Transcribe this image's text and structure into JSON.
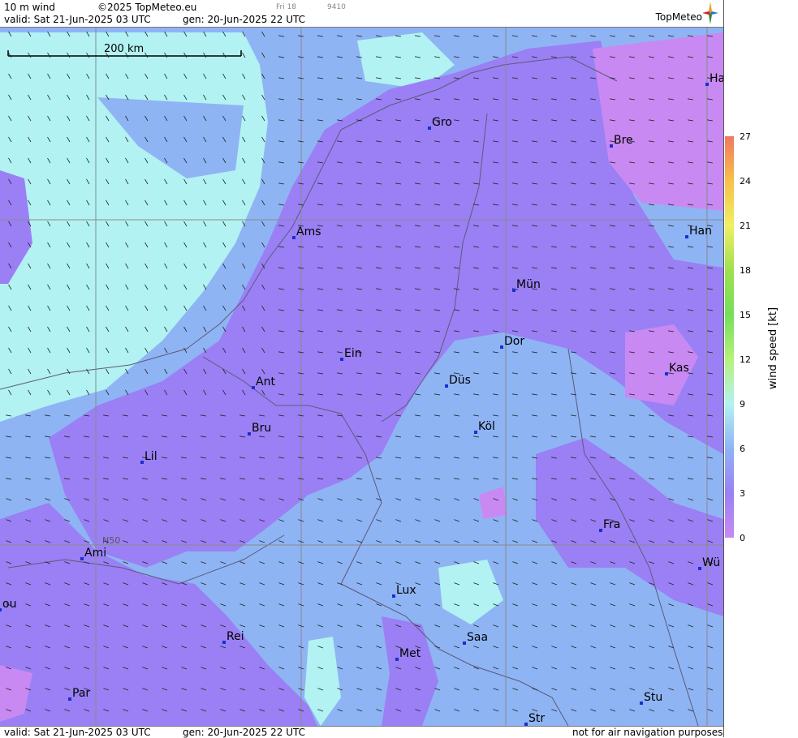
{
  "header": {
    "product": "10 m wind",
    "copyright": "©2025 TopMeteo.eu",
    "valid": "valid:  Sat  21-Jun-2025  03 UTC",
    "gen": "gen: 20-Jun-2025 22 UTC",
    "day_small": "Fri 18",
    "code_small": "9410",
    "brand": "TopMeteo"
  },
  "map": {
    "scale_label": "200 km",
    "lat_label": "N50",
    "cities": [
      {
        "name": "Gro"
      },
      {
        "name": "Bre"
      },
      {
        "name": "Ha"
      },
      {
        "name": "Ams"
      },
      {
        "name": "Han"
      },
      {
        "name": "Mün"
      },
      {
        "name": "Dor"
      },
      {
        "name": "Ein"
      },
      {
        "name": "Kas"
      },
      {
        "name": "Ant"
      },
      {
        "name": "Düs"
      },
      {
        "name": "Bru"
      },
      {
        "name": "Köl"
      },
      {
        "name": "Lil"
      },
      {
        "name": "Fra"
      },
      {
        "name": "Ami"
      },
      {
        "name": "Wü"
      },
      {
        "name": "ou"
      },
      {
        "name": "Lux"
      },
      {
        "name": "Rei"
      },
      {
        "name": "Saa"
      },
      {
        "name": "Met"
      },
      {
        "name": "Par"
      },
      {
        "name": "Stu"
      },
      {
        "name": "Str"
      }
    ]
  },
  "colorbar": {
    "label": "wind speed  [kt]",
    "ticks": [
      "27",
      "24",
      "21",
      "18",
      "15",
      "12",
      "9",
      "6",
      "3",
      "0"
    ],
    "colors": {
      "c0": "#c88af2",
      "c3": "#9a80f4",
      "c6": "#8fb4f4",
      "c9": "#b2f2f2",
      "c12": "#b6f27a",
      "c15": "#74e05a",
      "c18": "#a0e050",
      "c21": "#f0f060",
      "c24": "#f8c048",
      "c27": "#f07860"
    }
  },
  "footer": {
    "valid": "valid:  Sat  21-Jun-2025  03 UTC",
    "gen": "gen: 20-Jun-2025 22 UTC",
    "disclaimer": "not for air navigation purposes"
  }
}
